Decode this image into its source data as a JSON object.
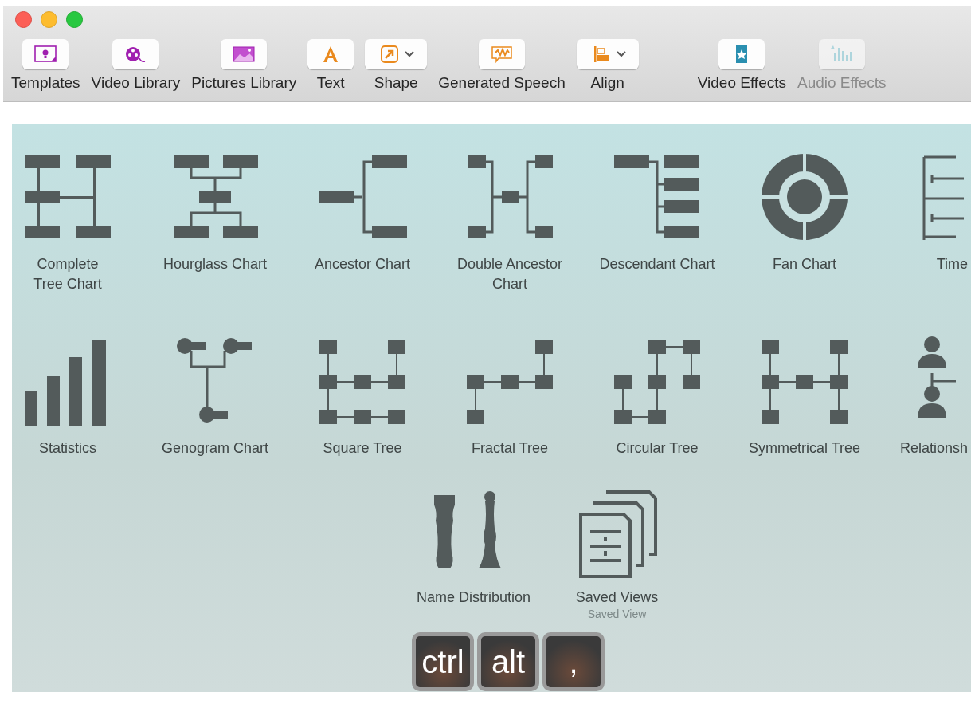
{
  "toolbar": [
    {
      "label": "Templates",
      "kind": "button",
      "disabled": false
    },
    {
      "label": "Video Library",
      "kind": "button",
      "disabled": false
    },
    {
      "label": "Pictures Library",
      "kind": "button",
      "disabled": false
    },
    {
      "label": "Text",
      "kind": "button",
      "disabled": false
    },
    {
      "label": "Shape",
      "kind": "dropdown",
      "disabled": false
    },
    {
      "label": "Generated Speech",
      "kind": "button",
      "disabled": false
    },
    {
      "label": "Align",
      "kind": "dropdown",
      "disabled": false
    },
    {
      "label": "Video Effects",
      "kind": "button",
      "disabled": false
    },
    {
      "label": "Audio Effects",
      "kind": "button",
      "disabled": true
    }
  ],
  "charts": [
    [
      {
        "label": "Complete\nTree Chart",
        "kind": "complete"
      },
      {
        "label": "Hourglass Chart",
        "kind": "hourglass"
      },
      {
        "label": "Ancestor Chart",
        "kind": "ancestor"
      },
      {
        "label": "Double Ancestor\nChart",
        "kind": "double"
      },
      {
        "label": "Descendant Chart",
        "kind": "descendant"
      },
      {
        "label": "Fan Chart",
        "kind": "fan"
      },
      {
        "label": "Time",
        "kind": "timeline"
      }
    ],
    [
      {
        "label": "Statistics",
        "kind": "statistics"
      },
      {
        "label": "Genogram Chart",
        "kind": "genogram"
      },
      {
        "label": "Square Tree",
        "kind": "square"
      },
      {
        "label": "Fractal Tree",
        "kind": "fractal"
      },
      {
        "label": "Circular Tree",
        "kind": "circular"
      },
      {
        "label": "Symmetrical Tree",
        "kind": "symmetrical"
      },
      {
        "label": "Relationsh",
        "kind": "relationship"
      }
    ],
    [
      {
        "label": "Name Distribution",
        "kind": "names"
      },
      {
        "label": "Saved Views",
        "sublabel": "Saved View",
        "kind": "saved"
      }
    ]
  ],
  "keys": [
    "ctrl",
    "alt",
    ","
  ]
}
